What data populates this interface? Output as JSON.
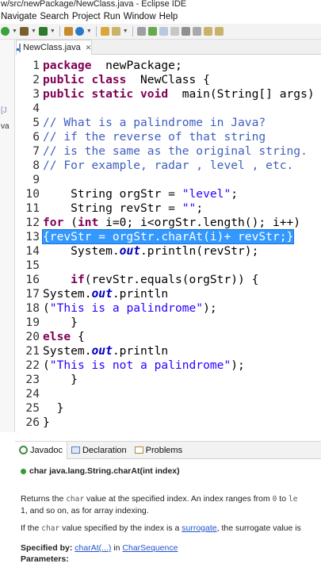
{
  "window": {
    "title": "w/src/newPackage/NewClass.java - Eclipse IDE"
  },
  "menu": [
    "Navigate",
    "Search",
    "Project",
    "Run",
    "Window",
    "Help"
  ],
  "toolbar": {
    "icons": [
      "run-icon",
      "debug-icon",
      "profile-icon",
      "new-icon",
      "save-icon",
      "open-type-icon",
      "search-icon",
      "pin-icon",
      "toggle-icon",
      "mark-icon",
      "show-whitespace-icon",
      "next-annotation-icon",
      "prev-annotation-icon",
      "back-icon",
      "forward-icon"
    ]
  },
  "left_pane": {
    "label_1": "[J",
    "label_2": "va"
  },
  "editor": {
    "tab_label": "NewClass.java",
    "tab_close": "✕",
    "lines": [
      {
        "n": "1",
        "parts": [
          [
            "kw",
            "package"
          ],
          [
            "",
            "  newPackage;"
          ]
        ]
      },
      {
        "n": "2",
        "parts": [
          [
            "kw",
            "public class"
          ],
          [
            "",
            "  NewClass {"
          ]
        ]
      },
      {
        "n": "3",
        "parts": [
          [
            "kw",
            "public static void"
          ],
          [
            "",
            "  main(String[] args) {"
          ]
        ]
      },
      {
        "n": "4",
        "parts": []
      },
      {
        "n": "5",
        "parts": [
          [
            "cm",
            "// What is a palindrome in Java?"
          ]
        ]
      },
      {
        "n": "6",
        "parts": [
          [
            "cm",
            "// if the reverse of that string"
          ]
        ]
      },
      {
        "n": "7",
        "parts": [
          [
            "cm",
            "// is the same as the original string."
          ]
        ]
      },
      {
        "n": "8",
        "parts": [
          [
            "cm",
            "// For example, radar , level , etc."
          ]
        ]
      },
      {
        "n": "9",
        "parts": []
      },
      {
        "n": "10",
        "parts": [
          [
            "",
            "    String orgStr = "
          ],
          [
            "str",
            "\"level\""
          ],
          [
            "",
            ";"
          ]
        ]
      },
      {
        "n": "11",
        "parts": [
          [
            "",
            "    String revStr = "
          ],
          [
            "str",
            "\"\""
          ],
          [
            "",
            ";"
          ]
        ]
      },
      {
        "n": "12",
        "parts": [
          [
            "kw",
            "for"
          ],
          [
            "",
            " ("
          ],
          [
            "kw",
            "int"
          ],
          [
            "",
            " i=0; i<orgStr.length(); i++)"
          ]
        ]
      },
      {
        "n": "13",
        "parts": [
          [
            "sel",
            "{revStr = orgStr.charAt(i)+ revStr;}"
          ]
        ]
      },
      {
        "n": "14",
        "parts": [
          [
            "",
            "    System."
          ],
          [
            "fld",
            "out"
          ],
          [
            "",
            ".println(revStr);"
          ]
        ]
      },
      {
        "n": "15",
        "parts": []
      },
      {
        "n": "16",
        "parts": [
          [
            "",
            "    "
          ],
          [
            "kw",
            "if"
          ],
          [
            "",
            "(revStr.equals(orgStr)) {"
          ]
        ]
      },
      {
        "n": "17",
        "parts": [
          [
            "",
            "System."
          ],
          [
            "fld",
            "out"
          ],
          [
            "",
            ".println"
          ]
        ]
      },
      {
        "n": "18",
        "parts": [
          [
            "",
            "("
          ],
          [
            "str",
            "\"This is a palindrome\""
          ],
          [
            "",
            ");"
          ]
        ]
      },
      {
        "n": "19",
        "parts": [
          [
            "",
            "    }"
          ]
        ]
      },
      {
        "n": "20",
        "parts": [
          [
            "kw",
            "else"
          ],
          [
            "",
            " {"
          ]
        ]
      },
      {
        "n": "21",
        "parts": [
          [
            "",
            "System."
          ],
          [
            "fld",
            "out"
          ],
          [
            "",
            ".println"
          ]
        ]
      },
      {
        "n": "22",
        "parts": [
          [
            "",
            "("
          ],
          [
            "str",
            "\"This is not a palindrome\""
          ],
          [
            "",
            ");"
          ]
        ]
      },
      {
        "n": "23",
        "parts": [
          [
            "",
            "    }"
          ]
        ]
      },
      {
        "n": "24",
        "parts": []
      },
      {
        "n": "25",
        "parts": [
          [
            "",
            "  }"
          ]
        ]
      },
      {
        "n": "26",
        "parts": [
          [
            "",
            "}"
          ]
        ]
      }
    ]
  },
  "bottom": {
    "tabs": [
      {
        "label": "Javadoc",
        "icon": "at-icon"
      },
      {
        "label": "Declaration",
        "icon": "declaration-icon"
      },
      {
        "label": "Problems",
        "icon": "problems-icon"
      }
    ],
    "signature": "char java.lang.String.charAt(int index)",
    "para1_a": "Returns the ",
    "para1_code1": "char",
    "para1_b": " value at the specified index. An index ranges from ",
    "para1_code2": "0",
    "para1_c": " to ",
    "para1_code3": "le",
    "para1_line2": "1, and so on, as for array indexing.",
    "para2_a": "If the ",
    "para2_code": "char",
    "para2_b": " value specified by the index is a ",
    "para2_link": "surrogate",
    "para2_c": ", the surrogate value is",
    "specified_by_label": "Specified by:",
    "specified_by_link": "charAt(...)",
    "specified_by_in": " in ",
    "specified_by_link2": "CharSequence",
    "parameters_label": "Parameters:"
  }
}
